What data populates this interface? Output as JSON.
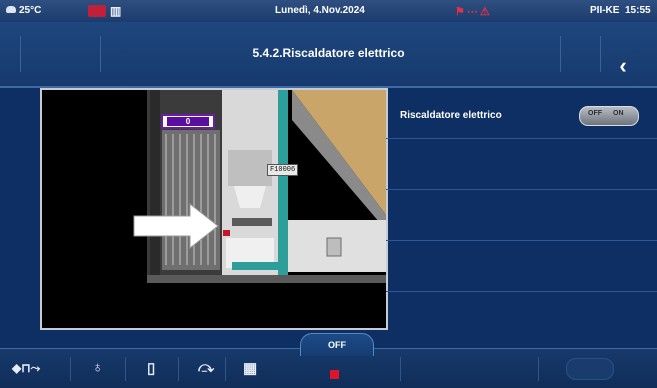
{
  "status_bar": {
    "temperature": "25°C",
    "date": "Lunedì, 4.Nov.2024",
    "user": "PII-KE",
    "time": "15:55"
  },
  "header": {
    "title": "5.4.2.Riscaldatore elettrico",
    "back_icon": "chevron-left-icon"
  },
  "image": {
    "counter_value": "0",
    "sensor_label": "F10006",
    "arrow_icon": "arrow-right-icon"
  },
  "settings": [
    {
      "label": "Riscaldatore elettrico",
      "toggle_off": "OFF",
      "toggle_on": "ON",
      "state": "OFF"
    }
  ],
  "toolbar": {
    "mode_label": "OFF",
    "icons": [
      "heating-mode-icon",
      "flame-icon",
      "tank-icon",
      "fan-icon",
      "grid-icon"
    ],
    "colors": {
      "accent": "#2d7bd6",
      "alarm": "#e01428"
    }
  }
}
